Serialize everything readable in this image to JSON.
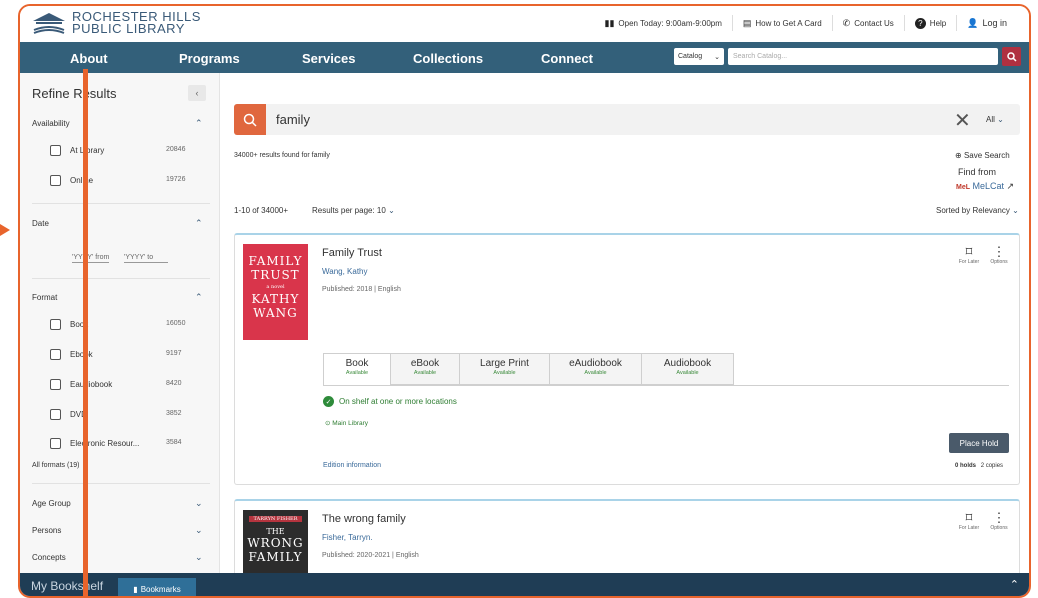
{
  "topbar": {
    "logo_line1": "ROCHESTER HILLS",
    "logo_line2": "PUBLIC LIBRARY",
    "open_today": "Open Today: 9:00am-9:00pm",
    "how_to_card": "How to Get A Card",
    "contact": "Contact Us",
    "help": "Help",
    "login": "Log in"
  },
  "nav": {
    "items": [
      "About",
      "Programs",
      "Services",
      "Collections",
      "Connect"
    ],
    "catalog_select": "Catalog",
    "search_placeholder": "Search Catalog..."
  },
  "sidebar": {
    "title": "Refine Results",
    "collapse_glyph": "‹",
    "availability": {
      "label": "Availability",
      "options": [
        {
          "label": "At Library",
          "count": "20846"
        },
        {
          "label": "Online",
          "count": "19726"
        }
      ]
    },
    "date": {
      "label": "Date",
      "from_placeholder": "'YYYY' from",
      "to_placeholder": "'YYYY' to"
    },
    "format": {
      "label": "Format",
      "options": [
        {
          "label": "Book",
          "count": "16050"
        },
        {
          "label": "Ebook",
          "count": "9197"
        },
        {
          "label": "Eaudiobook",
          "count": "8420"
        },
        {
          "label": "DVD",
          "count": "3852"
        },
        {
          "label": "Electronic Resour...",
          "count": "3584"
        }
      ],
      "all_formats": "All formats (19)"
    },
    "collapsed_sections": [
      "Age Group",
      "Persons",
      "Concepts"
    ]
  },
  "search": {
    "query": "family",
    "scope": "All",
    "results_found": "34000+ results found for family",
    "save_search": "Save Search",
    "find_from": "Find from",
    "melcat": "MeLCat",
    "pager": "1-10 of 34000+",
    "per_page": "Results per page: 10",
    "sorted_by": "Sorted by Relevancy"
  },
  "results": [
    {
      "title": "Family Trust",
      "author": "Wang, Kathy",
      "published": "Published: 2018 | English",
      "cover_text": [
        "FAMILY",
        "TRUST",
        "a novel",
        "KATHY",
        "WANG"
      ],
      "cover_color": "#d9354b",
      "formats": [
        {
          "name": "Book",
          "status": "Available"
        },
        {
          "name": "eBook",
          "status": "Available"
        },
        {
          "name": "Large Print",
          "status": "Available"
        },
        {
          "name": "eAudiobook",
          "status": "Available"
        },
        {
          "name": "Audiobook",
          "status": "Available"
        }
      ],
      "shelf_status": "On shelf at one or more locations",
      "branch": "Main Library",
      "place_hold": "Place Hold",
      "edition_info": "Edition information",
      "holds": "0 holds",
      "copies": "2 copies",
      "for_later": "For Later",
      "options": "Options"
    },
    {
      "title": "The wrong family",
      "author": "Fisher, Tarryn.",
      "published": "Published: 2020-2021 | English",
      "cover_text": [
        "TARRYN FISHER",
        "THE",
        "WRONG",
        "FAMILY"
      ],
      "cover_color": "#2c2c2c",
      "for_later": "For Later",
      "options": "Options"
    }
  ],
  "bottombar": {
    "title": "My Bookshelf",
    "tab": "Bookmarks"
  },
  "colors": {
    "nav_bg": "#33607a",
    "accent_orange": "#e8642c",
    "search_button": "#b03040",
    "bottom_bar": "#1f3d55"
  }
}
